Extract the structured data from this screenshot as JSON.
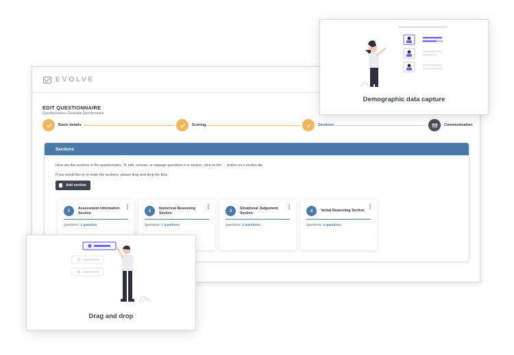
{
  "app": {
    "logo_text": "EVOLVE",
    "page_title": "EDIT QUESTIONNAIRE",
    "breadcrumb": "Questionnaires / Example Questionnaire"
  },
  "stepper": [
    {
      "label": "Basic details",
      "state": "done",
      "icon": "check-icon"
    },
    {
      "label": "Scoring",
      "state": "done",
      "icon": "check-icon"
    },
    {
      "label": "Sections",
      "state": "active",
      "icon": "pencil-icon"
    },
    {
      "label": "Communication",
      "state": "pending",
      "icon": "envelope-icon"
    }
  ],
  "sections_panel": {
    "title": "Sections",
    "intro": "Here are the sections in the questionnaire. To edit, remove, or manage questions in a section, click on the ⋮ button on a section tile.",
    "reorder_hint": "If you would like to re-order the sections, please drag and drop the tiles.",
    "add_button": "Add section",
    "questions_prefix": "Questions: ",
    "tiles": [
      {
        "number": "1",
        "name": "Assessment Information Section",
        "questions": "1 question"
      },
      {
        "number": "2",
        "name": "Numerical Reasoning Section",
        "questions": "7 questions"
      },
      {
        "number": "3",
        "name": "Situational Judgement Section",
        "questions": "4 questions"
      },
      {
        "number": "4",
        "name": "Verbal Reasoning Section",
        "questions": "4 questions"
      }
    ]
  },
  "cards": {
    "demographic": "Demographic data capture",
    "drag": "Drag and drop"
  },
  "colors": {
    "accent_blue": "#4a7aaa",
    "step_orange": "#f2b65a",
    "dark": "#3d4451",
    "illustration_purple": "#6c63ff"
  }
}
